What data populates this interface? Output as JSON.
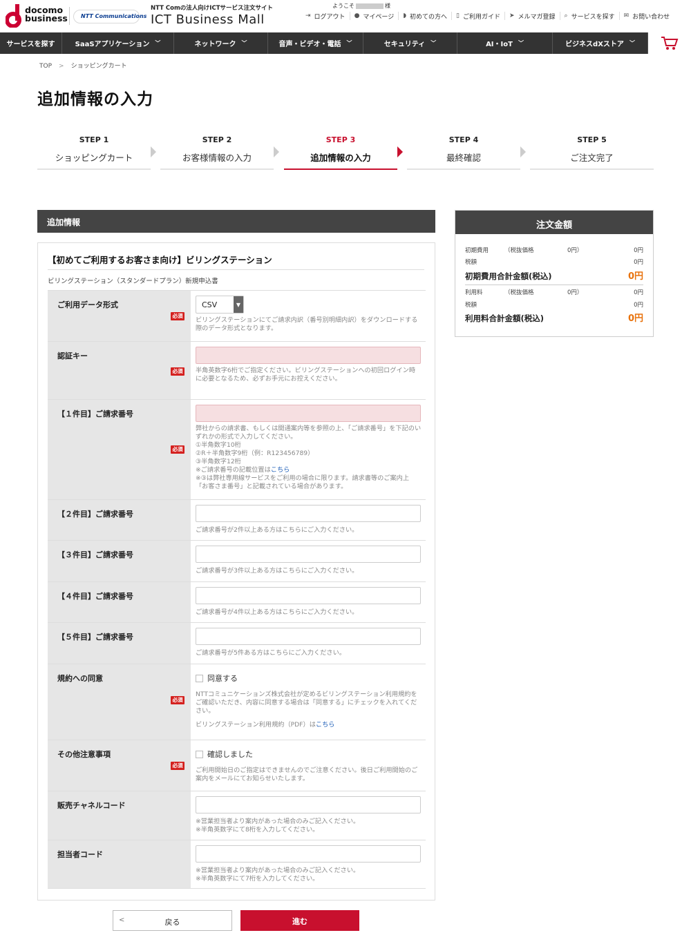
{
  "header": {
    "logo_line1": "docomo",
    "logo_line2": "business",
    "partner_logo": "NTT Communications",
    "tagline": "NTT Comの法人向けICTサービス注文サイト",
    "site_title": "ICT Business Mall",
    "welcome_prefix": "ようこそ",
    "welcome_suffix": "様",
    "nav": [
      {
        "icon": "logout-icon",
        "label": "ログアウト"
      },
      {
        "icon": "user-icon",
        "label": "マイページ"
      },
      {
        "icon": "beginner-icon",
        "label": "初めての方へ"
      },
      {
        "icon": "book-icon",
        "label": "ご利用ガイド"
      },
      {
        "icon": "send-icon",
        "label": "メルマガ登録"
      },
      {
        "icon": "search-icon",
        "label": "サービスを探す"
      },
      {
        "icon": "mail-icon",
        "label": "お問い合わせ"
      }
    ]
  },
  "global_nav": [
    {
      "label": "サービスを探す",
      "has_dropdown": false
    },
    {
      "label": "SaaSアプリケーション",
      "has_dropdown": true
    },
    {
      "label": "ネットワーク",
      "has_dropdown": true
    },
    {
      "label": "音声・ビデオ・電話",
      "has_dropdown": true
    },
    {
      "label": "セキュリティ",
      "has_dropdown": true
    },
    {
      "label": "AI・IoT",
      "has_dropdown": true
    },
    {
      "label": "ビジネスdXストア",
      "has_dropdown": true
    }
  ],
  "breadcrumb": {
    "home": "TOP",
    "current": "ショッピングカート"
  },
  "page_title": "追加情報の入力",
  "steps": [
    {
      "num": "STEP 1",
      "label": "ショッピングカート"
    },
    {
      "num": "STEP 2",
      "label": "お客様情報の入力"
    },
    {
      "num": "STEP 3",
      "label": "追加情報の入力"
    },
    {
      "num": "STEP 4",
      "label": "最終確認"
    },
    {
      "num": "STEP 5",
      "label": "ご注文完了"
    }
  ],
  "active_step": 3,
  "section_heading": "追加情報",
  "form": {
    "title": "【初めてご利用するお客さま向け】ビリングステーション",
    "subtitle": "ビリングステーション（スタンダードプラン）新規申込書",
    "required_badge": "必須",
    "data_format": {
      "label": "ご利用データ形式",
      "value": "CSV",
      "note": "ビリングステーションにてご請求内訳（番号別明細内訳）をダウンロードする際のデータ形式となります。"
    },
    "auth_key": {
      "label": "認証キー",
      "note": "半角英数字6桁でご指定ください。ビリングステーションへの初回ログイン時に必要となるため、必ずお手元にお控えください。"
    },
    "billing1": {
      "label": "【１件目】ご請求番号",
      "note1": "弊社からの請求書、もしくは開通案内等を参照の上、「ご請求番号」を下記のいずれかの形式で入力してください。",
      "note2": "①半角数字10桁",
      "note3": "②R＋半角数字9桁（例：R123456789）",
      "note4": "③半角数字12桁",
      "note5_prefix": "※ご請求番号の記載位置は",
      "note5_link": "こちら",
      "note6": "※③は弊社専用線サービスをご利用の場合に限ります。請求書等のご案内上「お客さま番号」と記載されている場合があります。"
    },
    "billing2": {
      "label": "【２件目】ご請求番号",
      "note": "ご請求番号が2件以上ある方はこちらにご入力ください。"
    },
    "billing3": {
      "label": "【３件目】ご請求番号",
      "note": "ご請求番号が3件以上ある方はこちらにご入力ください。"
    },
    "billing4": {
      "label": "【４件目】ご請求番号",
      "note": "ご請求番号が4件以上ある方はこちらにご入力ください。"
    },
    "billing5": {
      "label": "【５件目】ご請求番号",
      "note": "ご請求番号が5件ある方はこちらにご入力ください。"
    },
    "terms": {
      "label": "規約への同意",
      "checkbox": "同意する",
      "note": "NTTコミュニケーションズ株式会社が定めるビリングステーション利用規約をご確認いただき、内容に同意する場合は「同意する」にチェックを入れてください。",
      "pdf_prefix": "ビリングステーション利用規約（PDF）は",
      "pdf_link": "こちら"
    },
    "other_notes": {
      "label": "その他注意事項",
      "checkbox": "確認しました",
      "note": "ご利用開始日のご指定はできませんのでご注意ください。後日ご利用開始のご案内をメールにてお知らせいたします。"
    },
    "channel_code": {
      "label": "販売チャネルコード",
      "note1": "※営業担当者より案内があった場合のみご記入ください。",
      "note2": "※半角英数字にて8桁を入力してください。"
    },
    "rep_code": {
      "label": "担当者コード",
      "note1": "※営業担当者より案内があった場合のみご記入ください。",
      "note2": "※半角英数字にて7桁を入力してください。"
    }
  },
  "summary": {
    "title": "注文金額",
    "initial_label": "初期費用",
    "initial_tax_note": "（税抜価格",
    "initial_tax_amount": "0円）",
    "initial_value": "0円",
    "initial_tax_label": "税額",
    "initial_tax_value": "0円",
    "initial_total_label": "初期費用合計金額(税込)",
    "initial_total_value": "0円",
    "usage_label": "利用料",
    "usage_tax_note": "（税抜価格",
    "usage_tax_amount": "0円）",
    "usage_value": "0円",
    "usage_tax_label": "税額",
    "usage_tax_value": "0円",
    "usage_total_label": "利用料合計金額(税込)",
    "usage_total_value": "0円"
  },
  "buttons": {
    "back": "戻る",
    "next": "進む"
  },
  "colors": {
    "accent": "#c8102e",
    "dark": "#333333",
    "price": "#e8730e",
    "error_bg": "#f6dfe1"
  }
}
